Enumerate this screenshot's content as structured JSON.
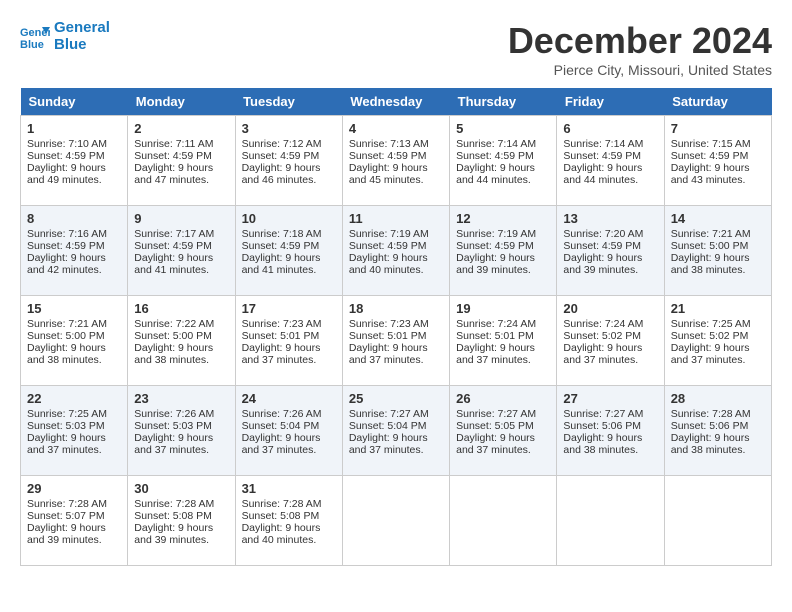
{
  "header": {
    "logo_line1": "General",
    "logo_line2": "Blue",
    "month": "December 2024",
    "location": "Pierce City, Missouri, United States"
  },
  "days_of_week": [
    "Sunday",
    "Monday",
    "Tuesday",
    "Wednesday",
    "Thursday",
    "Friday",
    "Saturday"
  ],
  "weeks": [
    [
      {
        "day": "1",
        "info": "Sunrise: 7:10 AM\nSunset: 4:59 PM\nDaylight: 9 hours\nand 49 minutes."
      },
      {
        "day": "2",
        "info": "Sunrise: 7:11 AM\nSunset: 4:59 PM\nDaylight: 9 hours\nand 47 minutes."
      },
      {
        "day": "3",
        "info": "Sunrise: 7:12 AM\nSunset: 4:59 PM\nDaylight: 9 hours\nand 46 minutes."
      },
      {
        "day": "4",
        "info": "Sunrise: 7:13 AM\nSunset: 4:59 PM\nDaylight: 9 hours\nand 45 minutes."
      },
      {
        "day": "5",
        "info": "Sunrise: 7:14 AM\nSunset: 4:59 PM\nDaylight: 9 hours\nand 44 minutes."
      },
      {
        "day": "6",
        "info": "Sunrise: 7:14 AM\nSunset: 4:59 PM\nDaylight: 9 hours\nand 44 minutes."
      },
      {
        "day": "7",
        "info": "Sunrise: 7:15 AM\nSunset: 4:59 PM\nDaylight: 9 hours\nand 43 minutes."
      }
    ],
    [
      {
        "day": "8",
        "info": "Sunrise: 7:16 AM\nSunset: 4:59 PM\nDaylight: 9 hours\nand 42 minutes."
      },
      {
        "day": "9",
        "info": "Sunrise: 7:17 AM\nSunset: 4:59 PM\nDaylight: 9 hours\nand 41 minutes."
      },
      {
        "day": "10",
        "info": "Sunrise: 7:18 AM\nSunset: 4:59 PM\nDaylight: 9 hours\nand 41 minutes."
      },
      {
        "day": "11",
        "info": "Sunrise: 7:19 AM\nSunset: 4:59 PM\nDaylight: 9 hours\nand 40 minutes."
      },
      {
        "day": "12",
        "info": "Sunrise: 7:19 AM\nSunset: 4:59 PM\nDaylight: 9 hours\nand 39 minutes."
      },
      {
        "day": "13",
        "info": "Sunrise: 7:20 AM\nSunset: 4:59 PM\nDaylight: 9 hours\nand 39 minutes."
      },
      {
        "day": "14",
        "info": "Sunrise: 7:21 AM\nSunset: 5:00 PM\nDaylight: 9 hours\nand 38 minutes."
      }
    ],
    [
      {
        "day": "15",
        "info": "Sunrise: 7:21 AM\nSunset: 5:00 PM\nDaylight: 9 hours\nand 38 minutes."
      },
      {
        "day": "16",
        "info": "Sunrise: 7:22 AM\nSunset: 5:00 PM\nDaylight: 9 hours\nand 38 minutes."
      },
      {
        "day": "17",
        "info": "Sunrise: 7:23 AM\nSunset: 5:01 PM\nDaylight: 9 hours\nand 37 minutes."
      },
      {
        "day": "18",
        "info": "Sunrise: 7:23 AM\nSunset: 5:01 PM\nDaylight: 9 hours\nand 37 minutes."
      },
      {
        "day": "19",
        "info": "Sunrise: 7:24 AM\nSunset: 5:01 PM\nDaylight: 9 hours\nand 37 minutes."
      },
      {
        "day": "20",
        "info": "Sunrise: 7:24 AM\nSunset: 5:02 PM\nDaylight: 9 hours\nand 37 minutes."
      },
      {
        "day": "21",
        "info": "Sunrise: 7:25 AM\nSunset: 5:02 PM\nDaylight: 9 hours\nand 37 minutes."
      }
    ],
    [
      {
        "day": "22",
        "info": "Sunrise: 7:25 AM\nSunset: 5:03 PM\nDaylight: 9 hours\nand 37 minutes."
      },
      {
        "day": "23",
        "info": "Sunrise: 7:26 AM\nSunset: 5:03 PM\nDaylight: 9 hours\nand 37 minutes."
      },
      {
        "day": "24",
        "info": "Sunrise: 7:26 AM\nSunset: 5:04 PM\nDaylight: 9 hours\nand 37 minutes."
      },
      {
        "day": "25",
        "info": "Sunrise: 7:27 AM\nSunset: 5:04 PM\nDaylight: 9 hours\nand 37 minutes."
      },
      {
        "day": "26",
        "info": "Sunrise: 7:27 AM\nSunset: 5:05 PM\nDaylight: 9 hours\nand 37 minutes."
      },
      {
        "day": "27",
        "info": "Sunrise: 7:27 AM\nSunset: 5:06 PM\nDaylight: 9 hours\nand 38 minutes."
      },
      {
        "day": "28",
        "info": "Sunrise: 7:28 AM\nSunset: 5:06 PM\nDaylight: 9 hours\nand 38 minutes."
      }
    ],
    [
      {
        "day": "29",
        "info": "Sunrise: 7:28 AM\nSunset: 5:07 PM\nDaylight: 9 hours\nand 39 minutes."
      },
      {
        "day": "30",
        "info": "Sunrise: 7:28 AM\nSunset: 5:08 PM\nDaylight: 9 hours\nand 39 minutes."
      },
      {
        "day": "31",
        "info": "Sunrise: 7:28 AM\nSunset: 5:08 PM\nDaylight: 9 hours\nand 40 minutes."
      },
      {
        "day": "",
        "info": ""
      },
      {
        "day": "",
        "info": ""
      },
      {
        "day": "",
        "info": ""
      },
      {
        "day": "",
        "info": ""
      }
    ]
  ]
}
